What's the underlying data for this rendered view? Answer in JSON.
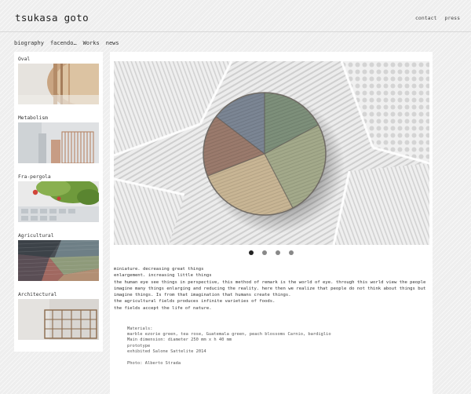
{
  "header": {
    "site_title": "tsukasa goto",
    "links": [
      "contact",
      "press"
    ]
  },
  "nav": {
    "items": [
      "biography",
      "facendo…",
      "Works",
      "news"
    ]
  },
  "sidebar": {
    "items": [
      {
        "label": "Oval"
      },
      {
        "label": "Metabolism"
      },
      {
        "label": "Fra-pergola"
      },
      {
        "label": "Agricultural"
      },
      {
        "label": "Architectural"
      }
    ]
  },
  "slideshow": {
    "dot_count": 4,
    "active_index": 0
  },
  "description": {
    "lines": [
      "miniature. decreasing great things",
      "enlargement. increasing little things",
      "the human eye see things in perspective, this method of remark is the world of eye. through this world view the people",
      "imagine many things enlarging and reducing the reality. here then we realize that people do not think about things but",
      "imagine things. Is from that imagination that humans create things.",
      "the agricultural fields produces infinite varieties of foods.",
      "the fields accept the life of nature."
    ]
  },
  "details": {
    "lines": [
      "Materials:",
      "marble ezorie green, tea rose, Guatemala green, peach blossoms Carnio, bardiglio",
      "Main dimension: diameter 250 mm x h 40 mm",
      "prototype",
      "exhibited Salone Sattelite 2014"
    ],
    "photo_credit": "Photo: Alberto Strada"
  },
  "colors": {
    "background": "#eeeeee",
    "panel": "#ffffff",
    "text": "#222222",
    "dot_inactive": "#888888",
    "dot_active": "#222222"
  }
}
